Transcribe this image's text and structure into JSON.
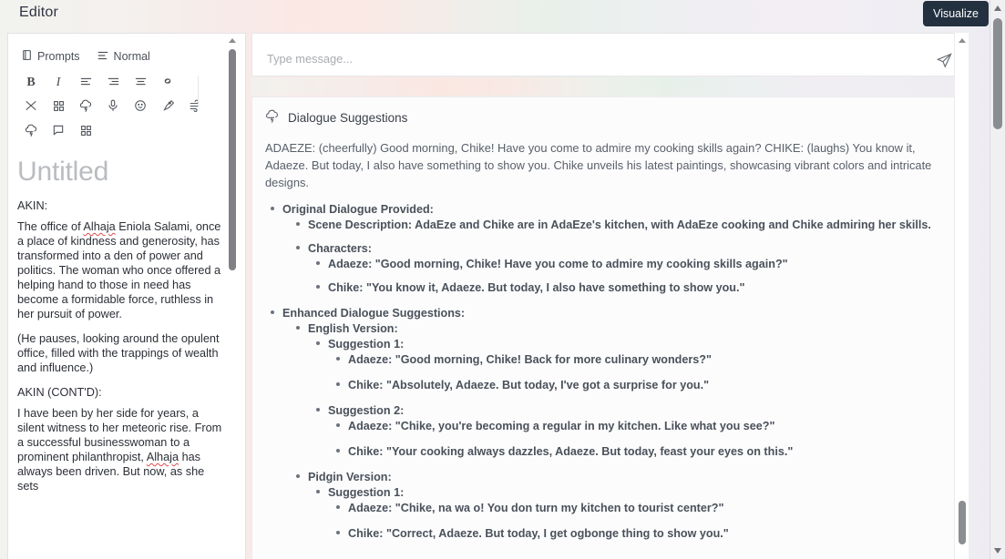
{
  "header": {
    "app_title": "Editor",
    "visualize_label": "Visualize"
  },
  "editor": {
    "toolbar": {
      "prompts_label": "Prompts",
      "format_label": "Normal",
      "bold_label": "B",
      "italic_label": "I",
      "icons_row1": [
        "book-icon",
        "paragraph-format-icon"
      ],
      "icons_row2": [
        "bold-icon",
        "italic-icon",
        "align-left-icon",
        "align-right-icon",
        "align-center-icon",
        "link-icon"
      ],
      "icons_row3": [
        "shuffle-icon",
        "grid-icon",
        "cloud-lightning-icon",
        "microphone-icon",
        "smiley-icon",
        "pen-nib-icon",
        "wind-icon"
      ],
      "icons_row4": [
        "cloud-lightning-icon",
        "comment-icon",
        "grid-icon"
      ]
    },
    "document_title": "Untitled",
    "paragraphs": [
      {
        "text": "AKIN:",
        "speaker": true
      },
      {
        "text": "The office of Alhaja Eniola Salami, once a place of kindness and generosity, has transformed into a den of power and politics. The woman who once offered a helping hand to those in need has become a formidable force, ruthless in her pursuit of power.",
        "speaker": false
      },
      {
        "text": "(He pauses, looking around the opulent office, filled with the trappings of wealth and influence.)",
        "speaker": false
      },
      {
        "text": "AKIN (CONT'D):",
        "speaker": true
      },
      {
        "text": "I have been by her side for years, a silent witness to her meteoric rise. From a successful businesswoman to a prominent philanthropist, Alhaja has always been driven. But now, as she sets",
        "speaker": false
      }
    ]
  },
  "chat": {
    "input_placeholder": "Type message...",
    "input_value": "",
    "send_icon": "paper-plane-icon",
    "resize_icon": "resize-grip-icon",
    "card_icon": "cloud-lightning-icon",
    "card_title": "Dialogue Suggestions",
    "intro": "ADAEZE: (cheerfully) Good morning, Chike! Have you come to admire my cooking skills again? CHIKE: (laughs) You know it, Adaeze. But today, I also have something to show you. Chike unveils his latest paintings, showcasing vibrant colors and intricate designs.",
    "sparkle_icon": "sparkles-icon",
    "tree": [
      {
        "text": "Original Dialogue Provided:",
        "bold": true,
        "sparkle": true,
        "children": [
          {
            "text": "Scene Description: AdaEze and Chike are in AdaEze's kitchen, with AdaEze cooking and Chike admiring her skills.",
            "bold": false,
            "children": []
          },
          {
            "text": "Characters:",
            "bold": false,
            "children": [
              {
                "text": "Adaeze: \"Good morning, Chike! Have you come to admire my cooking skills again?\"",
                "bold": false,
                "children": []
              },
              {
                "text": "Chike: \"You know it, Adaeze. But today, I also have something to show you.\"",
                "bold": false,
                "children": []
              }
            ]
          }
        ]
      },
      {
        "text": "Enhanced Dialogue Suggestions:",
        "bold": true,
        "sparkle": false,
        "children": [
          {
            "text": "English Version:",
            "bold": true,
            "children": [
              {
                "text": "Suggestion 1:",
                "bold": true,
                "children": [
                  {
                    "text": "Adaeze: \"Good morning, Chike! Back for more culinary wonders?\"",
                    "bold": false,
                    "children": []
                  },
                  {
                    "text": "Chike: \"Absolutely, Adaeze. But today, I've got a surprise for you.\"",
                    "bold": false,
                    "children": []
                  }
                ]
              },
              {
                "text": "Suggestion 2:",
                "bold": true,
                "children": [
                  {
                    "text": "Adaeze: \"Chike, you're becoming a regular in my kitchen. Like what you see?\"",
                    "bold": false,
                    "children": []
                  },
                  {
                    "text": "Chike: \"Your cooking always dazzles, Adaeze. But today, feast your eyes on this.\"",
                    "bold": false,
                    "children": []
                  }
                ]
              }
            ]
          },
          {
            "text": "Pidgin Version:",
            "bold": true,
            "children": [
              {
                "text": "Suggestion 1:",
                "bold": true,
                "children": [
                  {
                    "text": "Adaeze: \"Chike, na wa o! You don turn my kitchen to tourist center?\"",
                    "bold": false,
                    "children": []
                  },
                  {
                    "text": "Chike: \"Correct, Adaeze. But today, I get ogbonge thing to show you.\"",
                    "bold": false,
                    "children": []
                  }
                ]
              }
            ]
          }
        ]
      }
    ]
  },
  "colors": {
    "accent_dark": "#22303f",
    "text_primary": "#2b2f36",
    "text_muted": "#5d646d",
    "placeholder": "#a8abb0",
    "title_muted": "#b9bcc0",
    "spellcheck_underline": "#e04b4b"
  }
}
